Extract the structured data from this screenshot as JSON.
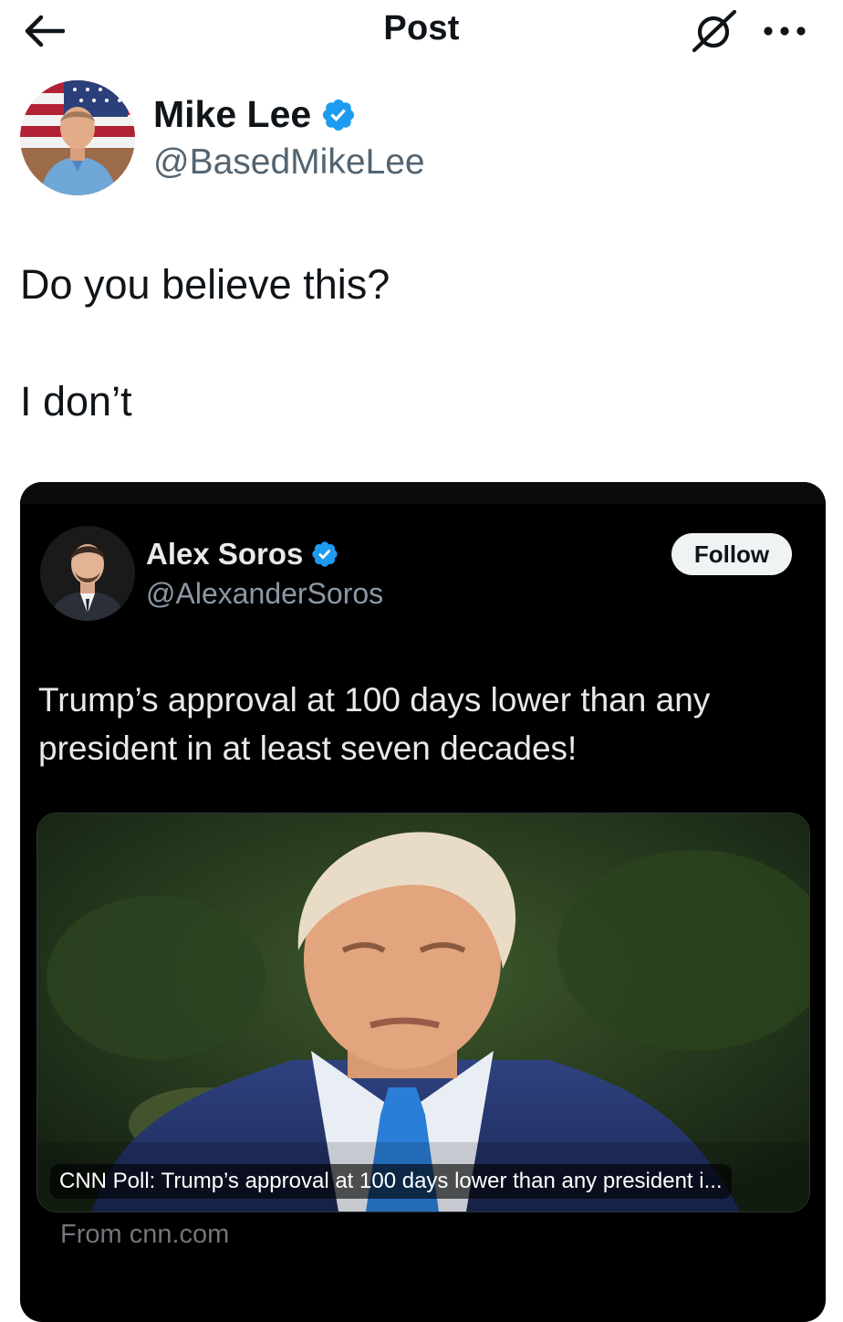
{
  "header": {
    "title": "Post",
    "back_icon": "arrow-left-icon",
    "grok_icon": "grok-icon",
    "more_icon": "more-horizontal-icon"
  },
  "author": {
    "name": "Mike Lee",
    "handle": "@BasedMikeLee",
    "verified": true,
    "verified_color": "#1d9bf0"
  },
  "post": {
    "lines": [
      "Do you believe this?",
      "I don’t"
    ]
  },
  "quoted_post": {
    "author_name": "Alex Soros",
    "author_handle": "@AlexanderSoros",
    "verified": true,
    "follow_label": "Follow",
    "text": "Trump’s approval at 100 days lower than any president in at least seven decades!",
    "link_card": {
      "title": "CNN Poll: Trump’s approval at 100 days lower than any president i...",
      "source": "From cnn.com"
    }
  },
  "colors": {
    "text_primary": "#0f1419",
    "text_secondary": "#536471",
    "embed_bg": "#000000",
    "embed_text": "#e7e9ea",
    "embed_secondary": "#8b98a5",
    "verified_blue": "#1d9bf0"
  }
}
